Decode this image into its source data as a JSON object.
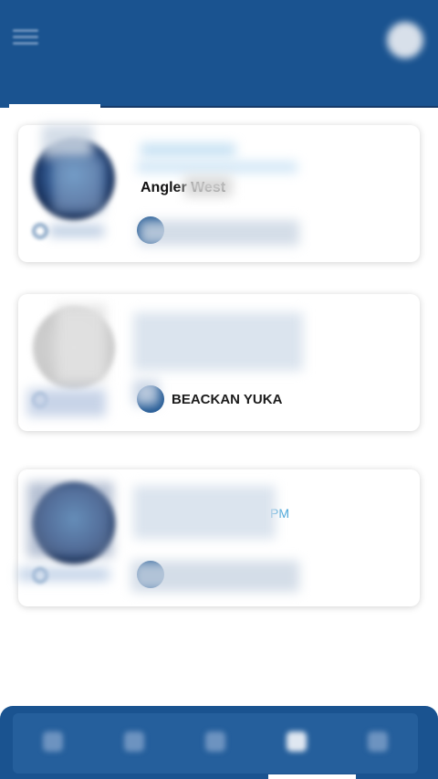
{
  "header": {
    "title": "",
    "tabs": [
      {
        "label": ""
      },
      {
        "label": ""
      },
      {
        "label": ""
      },
      {
        "label": ""
      }
    ]
  },
  "cards": [
    {
      "name": "",
      "date": "",
      "location": "Angler West",
      "status": "",
      "action": ""
    },
    {
      "name": "",
      "date": "",
      "location": "",
      "status": "",
      "action": "BEACKAN YUKA"
    },
    {
      "name": "",
      "date": "PM",
      "location": "",
      "status": "",
      "action": ""
    }
  ],
  "bottom_nav": {
    "items": [
      {
        "label": ""
      },
      {
        "label": ""
      },
      {
        "label": ""
      },
      {
        "label": ""
      },
      {
        "label": ""
      }
    ],
    "active_index": 3
  },
  "colors": {
    "brand": "#1a5390",
    "accent_text": "#4aa6d9"
  }
}
